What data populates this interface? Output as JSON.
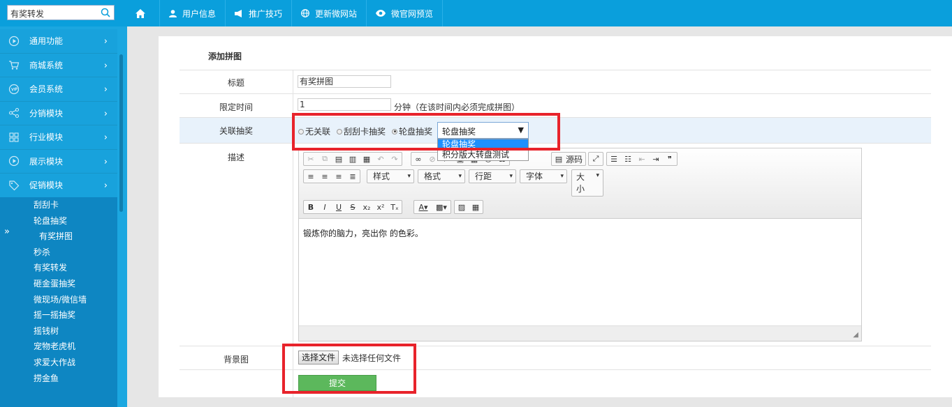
{
  "search": {
    "value": "有奖转发"
  },
  "topnav": {
    "items": [
      {
        "label": "用户信息",
        "icon": "user-icon"
      },
      {
        "label": "推广技巧",
        "icon": "megaphone-icon"
      },
      {
        "label": "更新微网站",
        "icon": "globe-icon"
      },
      {
        "label": "微官网预览",
        "icon": "eye-icon"
      }
    ]
  },
  "sidebar": {
    "menu": [
      {
        "label": "通用功能",
        "icon": "play-circle-icon"
      },
      {
        "label": "商城系统",
        "icon": "cart-icon"
      },
      {
        "label": "会员系统",
        "icon": "vip-icon"
      },
      {
        "label": "分销模块",
        "icon": "share-icon"
      },
      {
        "label": "行业模块",
        "icon": "grid-icon"
      },
      {
        "label": "展示模块",
        "icon": "play-circle-icon"
      },
      {
        "label": "促销模块",
        "icon": "tag-icon"
      }
    ],
    "chevron": "›",
    "arrows": "»",
    "submenu": [
      "刮刮卡",
      "轮盘抽奖",
      "有奖拼图",
      "秒杀",
      "有奖转发",
      "砸金蛋抽奖",
      "微现场/微信墙",
      "摇一摇抽奖",
      "摇钱树",
      "宠物老虎机",
      "求爱大作战",
      "捞金鱼"
    ]
  },
  "form": {
    "title": "添加拼图",
    "title_label": "标题",
    "title_value": "有奖拼图",
    "time_label": "限定时间",
    "time_value": "1",
    "time_suffix": "分钟（在该时间内必须完成拼图）",
    "lottery_label": "关联抽奖",
    "radios": [
      "无关联",
      "刮刮卡抽奖",
      "轮盘抽奖"
    ],
    "select_value": "轮盘抽奖",
    "select_caret": "▼",
    "dropdown_options": [
      "轮盘抽奖",
      "积分版大转盘测试"
    ],
    "desc_label": "描述",
    "editor": {
      "source_label": "源码",
      "style_label": "样式",
      "format_label": "格式",
      "linespacing_label": "行距",
      "font_label": "字体",
      "size_label": "大小",
      "content": "锻炼你的脑力，亮出你 的色彩。"
    },
    "bg_label": "背景图",
    "file_button": "选择文件",
    "file_status": "未选择任何文件",
    "submit": "提交"
  },
  "colors": {
    "topbar": "#0a9fdc",
    "sidebar": "#1ba7e0",
    "submenu": "#0e86c2",
    "highlight_row": "#e8f2fb",
    "submit": "#5cb85c",
    "annotation": "#e8232b"
  }
}
